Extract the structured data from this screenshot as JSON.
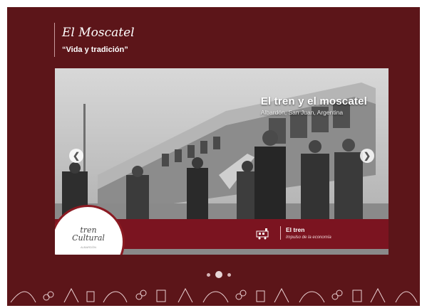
{
  "header": {
    "title": "El Moscatel",
    "tagline": "“Vida y tradición”"
  },
  "slide": {
    "title": "El tren y el moscatel",
    "subtitle": "Albardón, San Juan, Argentina",
    "logo_text": "tren\nCultural",
    "logo_small": "ALBARDÓN",
    "info_title": "El tren",
    "info_subtitle": "Impulso de la economía"
  },
  "controls": {
    "prev_label": "❮",
    "next_label": "❯"
  },
  "pagination": {
    "count": 3,
    "active_index": 1
  },
  "colors": {
    "panel": "#5c1519",
    "bar": "#7b1420",
    "accent": "#8b1a22"
  }
}
